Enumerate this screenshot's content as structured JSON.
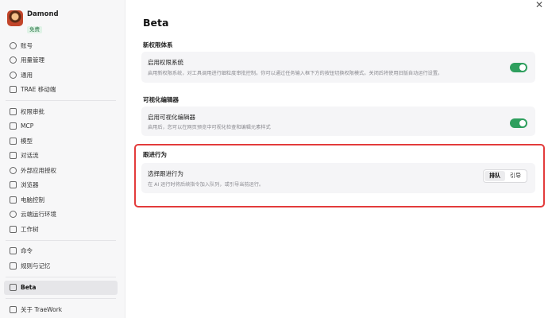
{
  "user": {
    "name": "Damond",
    "plan": "免费"
  },
  "sidebar": {
    "group1": [
      {
        "label": "账号",
        "icon": "user-circle-icon"
      },
      {
        "label": "用量管理",
        "icon": "gauge-icon"
      },
      {
        "label": "通用",
        "icon": "gear-icon"
      },
      {
        "label": "TRAE 移动端",
        "icon": "mobile-icon"
      }
    ],
    "group2": [
      {
        "label": "权限审批",
        "icon": "lock-icon"
      },
      {
        "label": "MCP",
        "icon": "mcp-icon"
      },
      {
        "label": "模型",
        "icon": "cube-icon"
      },
      {
        "label": "对话流",
        "icon": "chat-icon"
      },
      {
        "label": "外部应用授权",
        "icon": "key-icon"
      },
      {
        "label": "浏览器",
        "icon": "browser-icon"
      },
      {
        "label": "电脑控制",
        "icon": "monitor-icon"
      },
      {
        "label": "云端运行环境",
        "icon": "cloud-icon"
      },
      {
        "label": "工作树",
        "icon": "tree-icon"
      }
    ],
    "group3": [
      {
        "label": "命令",
        "icon": "terminal-icon"
      },
      {
        "label": "规则与记忆",
        "icon": "book-icon"
      }
    ],
    "group4": [
      {
        "label": "Beta",
        "icon": "beta-icon"
      }
    ],
    "group5": [
      {
        "label": "关于 TraeWork",
        "icon": "info-icon"
      }
    ]
  },
  "main": {
    "title": "Beta",
    "permission": {
      "section_title": "新权限体系",
      "card_title": "启用权限系统",
      "card_desc": "启用新权限系统，对工具调用进行细粒度审批控制。你可以通过任务输入框下方的按钮切换权限模式。关闭后将使用旧版自动运行设置。",
      "enabled": true
    },
    "visual_editor": {
      "section_title": "可视化编辑器",
      "card_title": "启用可视化编辑器",
      "card_desc": "启用后，您可以在网页预览中可视化检查和编辑元素样式",
      "enabled": true
    },
    "follow_up": {
      "section_title": "跟进行为",
      "card_title": "选择跟进行为",
      "card_desc": "在 AI 运行时将后续指令加入队列，或引导当前运行。",
      "options": [
        "排队",
        "引导"
      ],
      "selected": "排队"
    }
  },
  "colors": {
    "toggle_on": "#2f9f5e",
    "highlight_border": "#e33b3b"
  }
}
